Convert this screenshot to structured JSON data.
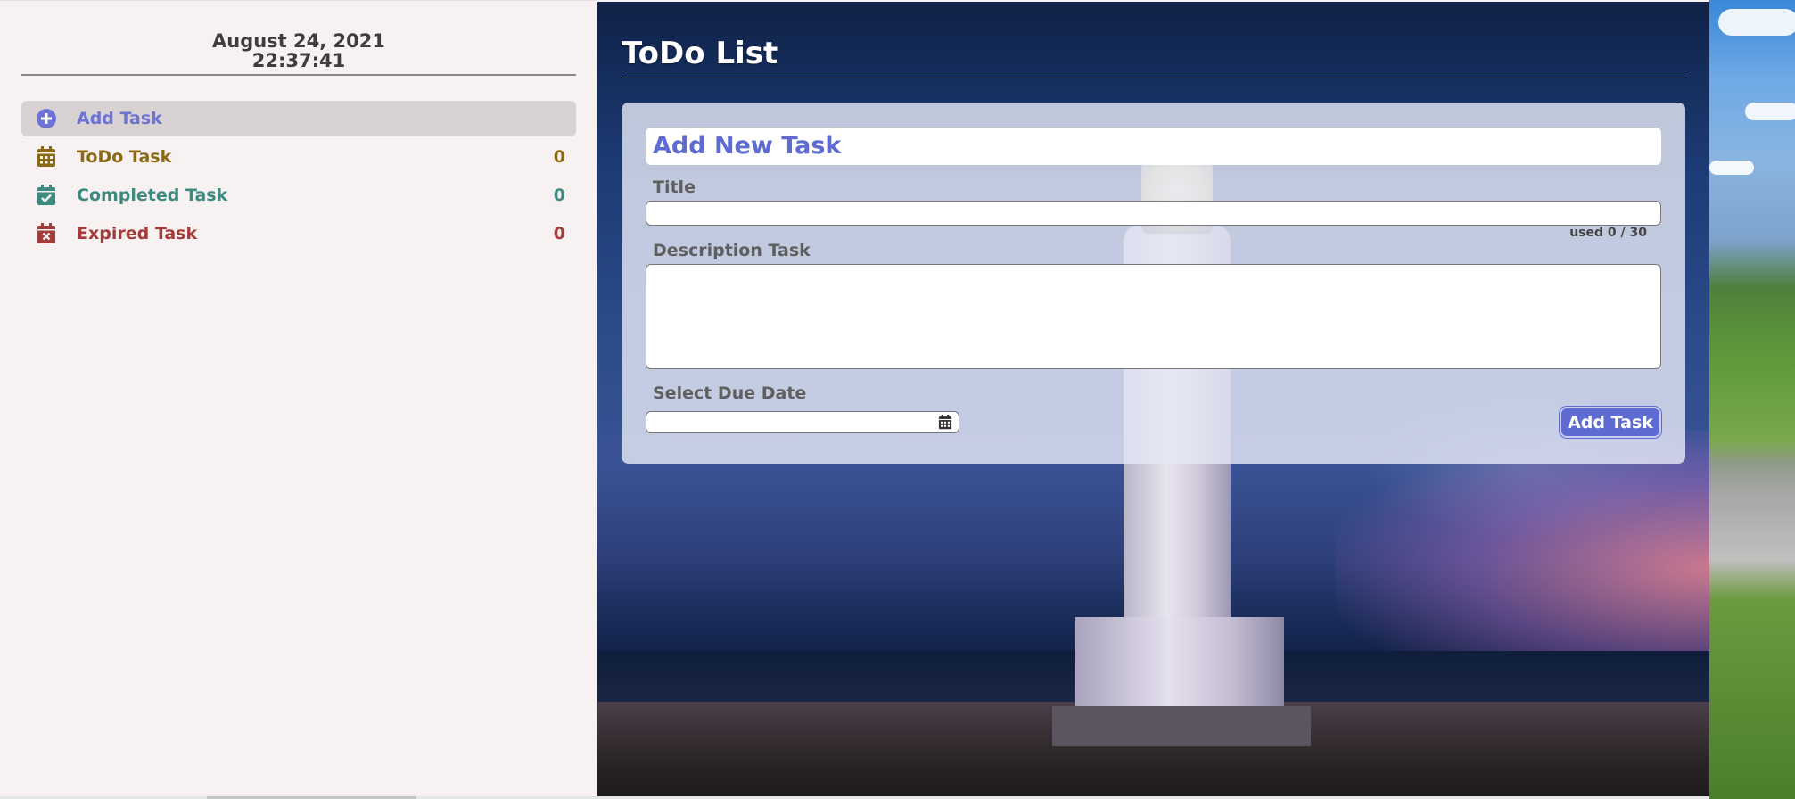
{
  "sidebar": {
    "date": "August 24, 2021",
    "time": "22:37:41",
    "menu": [
      {
        "label": "Add Task",
        "count": "",
        "icon": "plus-circle-icon",
        "color": "#6c74d6"
      },
      {
        "label": "ToDo Task",
        "count": "0",
        "icon": "calendar-icon",
        "color": "#8b6914"
      },
      {
        "label": "Completed Task",
        "count": "0",
        "icon": "calendar-check-icon",
        "color": "#3d8a80"
      },
      {
        "label": "Expired Task",
        "count": "0",
        "icon": "calendar-times-icon",
        "color": "#a33b3b"
      }
    ]
  },
  "main": {
    "title": "ToDo List",
    "form": {
      "heading": "Add New Task",
      "title_label": "Title",
      "title_value": "",
      "char_count": "used 0 / 30",
      "description_label": "Description Task",
      "description_value": "",
      "due_date_label": "Select Due Date",
      "due_date_value": "",
      "submit_label": "Add Task"
    }
  },
  "colors": {
    "accent": "#5d6bd3",
    "todo": "#8b6914",
    "completed": "#3d8a80",
    "expired": "#a33b3b"
  }
}
